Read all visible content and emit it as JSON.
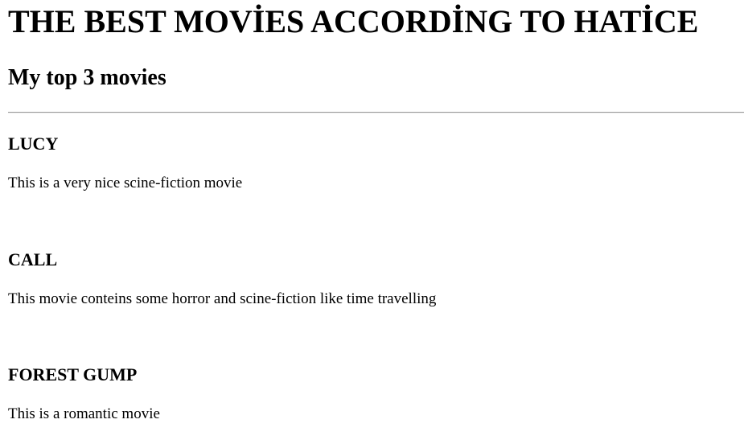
{
  "page": {
    "title": "THE BEST MOVİES ACCORDİNG TO HATİCE",
    "subtitle": "My top 3 movies"
  },
  "movies": [
    {
      "title": "LUCY",
      "description": "This is a very nice scine-fiction movie"
    },
    {
      "title": "CALL",
      "description": "This movie conteins some horror and scine-fiction like time travelling"
    },
    {
      "title": "FOREST GUMP",
      "description": "This is a romantic movie"
    }
  ]
}
